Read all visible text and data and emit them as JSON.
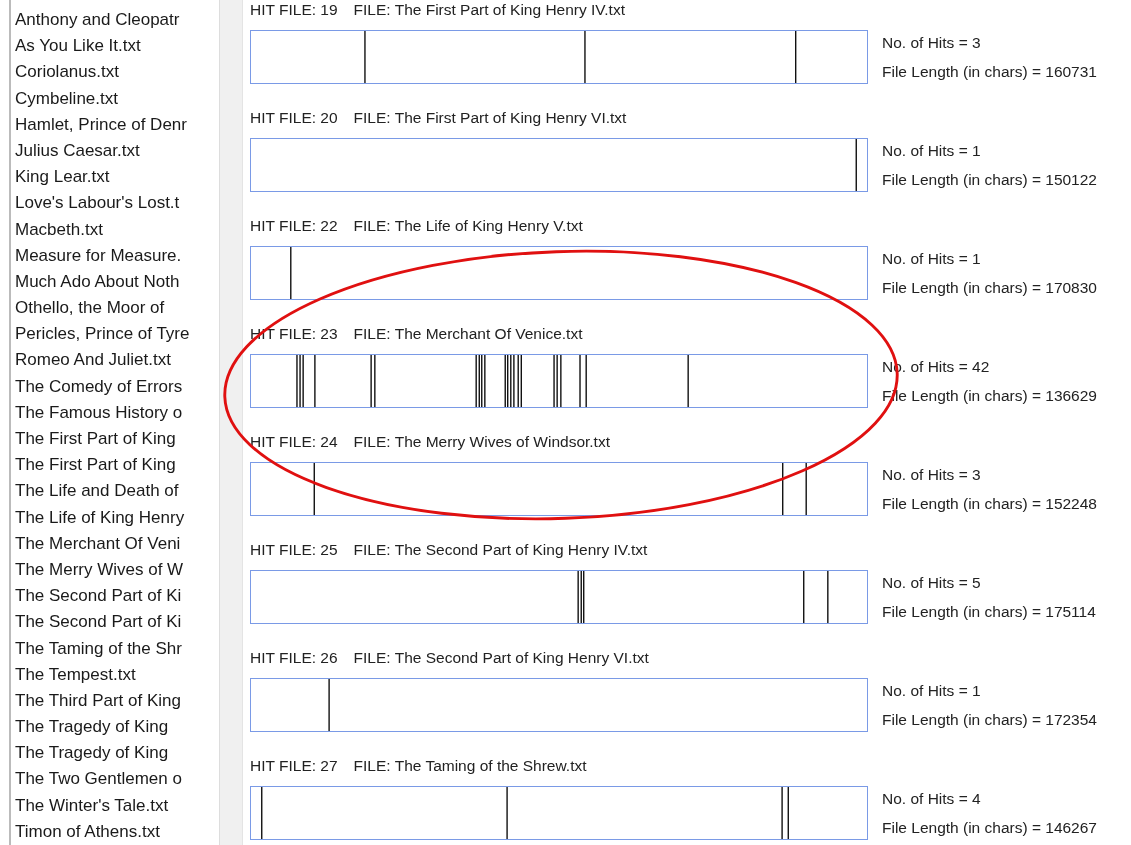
{
  "file_list": {
    "items": [
      {
        "label": "Anthony and Cleopatr"
      },
      {
        "label": "As You Like It.txt"
      },
      {
        "label": "Coriolanus.txt"
      },
      {
        "label": "Cymbeline.txt"
      },
      {
        "label": "Hamlet, Prince of Denr"
      },
      {
        "label": "Julius Caesar.txt"
      },
      {
        "label": "King Lear.txt"
      },
      {
        "label": "Love's Labour's Lost.t"
      },
      {
        "label": "Macbeth.txt"
      },
      {
        "label": "Measure for Measure."
      },
      {
        "label": "Much Ado About Noth"
      },
      {
        "label": "Othello, the Moor of"
      },
      {
        "label": "Pericles, Prince of Tyre"
      },
      {
        "label": "Romeo And Juliet.txt"
      },
      {
        "label": "The Comedy of Errors"
      },
      {
        "label": "The Famous History o"
      },
      {
        "label": "The First Part of King"
      },
      {
        "label": "The First Part of King"
      },
      {
        "label": "The Life and Death of"
      },
      {
        "label": "The Life of King Henry"
      },
      {
        "label": "The Merchant Of Veni"
      },
      {
        "label": "The Merry Wives of W"
      },
      {
        "label": "The Second Part of Ki"
      },
      {
        "label": "The Second Part of Ki"
      },
      {
        "label": "The Taming of the Shr"
      },
      {
        "label": "The Tempest.txt"
      },
      {
        "label": "The Third Part of King"
      },
      {
        "label": "The Tragedy of King"
      },
      {
        "label": "The Tragedy of King"
      },
      {
        "label": "The Two Gentlemen o"
      },
      {
        "label": "The Winter's Tale.txt"
      },
      {
        "label": "Timon of Athens.txt"
      }
    ]
  },
  "results": [
    {
      "hit_file": "HIT FILE: 19",
      "file": "FILE: The First Part of King Henry IV.txt",
      "hits": "No. of Hits = 3",
      "length": "File Length (in chars) = 160731"
    },
    {
      "hit_file": "HIT FILE: 20",
      "file": "FILE: The First Part of King Henry VI.txt",
      "hits": "No. of Hits = 1",
      "length": "File Length (in chars) = 150122"
    },
    {
      "hit_file": "HIT FILE: 22",
      "file": "FILE: The Life of King Henry V.txt",
      "hits": "No. of Hits = 1",
      "length": "File Length (in chars) = 170830"
    },
    {
      "hit_file": "HIT FILE: 23",
      "file": "FILE: The Merchant Of Venice.txt",
      "hits": "No. of Hits = 42",
      "length": "File Length (in chars) = 136629"
    },
    {
      "hit_file": "HIT FILE: 24",
      "file": "FILE: The Merry Wives of Windsor.txt",
      "hits": "No. of Hits = 3",
      "length": "File Length (in chars) = 152248"
    },
    {
      "hit_file": "HIT FILE: 25",
      "file": "FILE: The Second Part of King Henry IV.txt",
      "hits": "No. of Hits = 5",
      "length": "File Length (in chars) = 175114"
    },
    {
      "hit_file": "HIT FILE: 26",
      "file": "FILE: The Second Part of King Henry VI.txt",
      "hits": "No. of Hits = 1",
      "length": "File Length (in chars) = 172354"
    },
    {
      "hit_file": "HIT FILE: 27",
      "file": "FILE: The Taming of the Shrew.txt",
      "hits": "No. of Hits = 4",
      "length": "File Length (in chars) = 146267"
    }
  ]
}
